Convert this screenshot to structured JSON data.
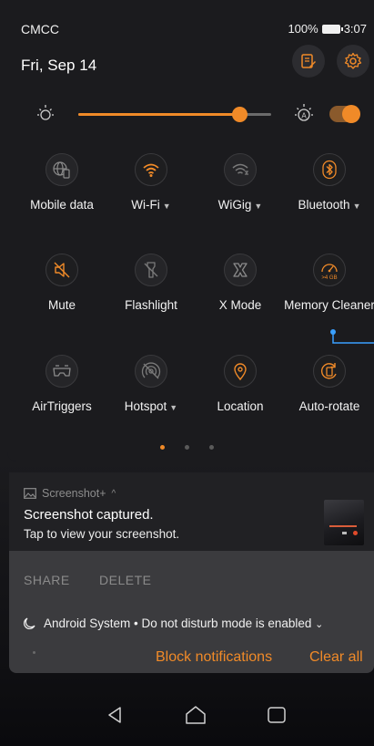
{
  "status_bar": {
    "carrier": "CMCC",
    "battery": "100%",
    "time": "3:07"
  },
  "header": {
    "date": "Fri, Sep 14"
  },
  "brightness": {
    "level": 0.84,
    "auto": true
  },
  "tiles": [
    {
      "label": "Mobile data",
      "caret": false,
      "active": false,
      "icon": "globe-icon"
    },
    {
      "label": "Wi-Fi",
      "caret": true,
      "active": true,
      "icon": "wifi-icon"
    },
    {
      "label": "WiGig",
      "caret": true,
      "active": false,
      "icon": "wigig-icon"
    },
    {
      "label": "Bluetooth",
      "caret": true,
      "active": true,
      "icon": "bluetooth-icon"
    },
    {
      "label": "Mute",
      "caret": false,
      "active": true,
      "icon": "mute-icon"
    },
    {
      "label": "Flashlight",
      "caret": false,
      "active": false,
      "icon": "flashlight-icon"
    },
    {
      "label": "X Mode",
      "caret": false,
      "active": false,
      "icon": "x-mode-icon"
    },
    {
      "label": "Memory Cleaner",
      "caret": false,
      "active": true,
      "icon": "memory-cleaner-icon",
      "badge": ">4 GB"
    },
    {
      "label": "AirTriggers",
      "caret": false,
      "active": false,
      "icon": "airtriggers-icon"
    },
    {
      "label": "Hotspot",
      "caret": true,
      "active": false,
      "icon": "hotspot-icon"
    },
    {
      "label": "Location",
      "caret": false,
      "active": true,
      "icon": "location-icon"
    },
    {
      "label": "Auto-rotate",
      "caret": false,
      "active": true,
      "icon": "auto-rotate-icon"
    }
  ],
  "pager": {
    "count": 3,
    "current": 0
  },
  "notification": {
    "app": "Screenshot+",
    "title": "Screenshot captured.",
    "text": "Tap to view your screenshot.",
    "actions": [
      "SHARE",
      "DELETE"
    ]
  },
  "dnd": {
    "text": "Android System • Do not disturb mode is enabled"
  },
  "footer": {
    "block": "Block notifications",
    "clear": "Clear all"
  },
  "caret_glyph": "▼",
  "colors": {
    "accent": "#f08a28",
    "panel": "#1b1b1e",
    "notification": "#3b3b3e"
  }
}
